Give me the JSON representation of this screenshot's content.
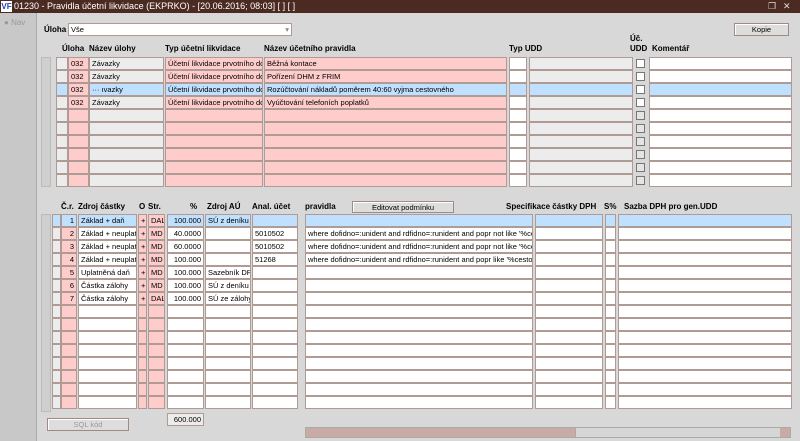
{
  "window": {
    "title": "01230 - Pravidla účetní likvidace (EKPRKO) - [20.06.2016; 08:03]  [ ]  [ ]",
    "logo": "VF",
    "restore_icon": "restore-icon",
    "close_icon": "close-icon"
  },
  "nav": {
    "label": "Nav"
  },
  "filter": {
    "label": "Úloha",
    "value": "Vše"
  },
  "buttons": {
    "kopie": "Kopie",
    "editovat": "Editovat podmínku",
    "sql": "SQL kód"
  },
  "top_grid": {
    "headers": {
      "uloha": "Úloha",
      "nazev": "Název úlohy",
      "typ": "Typ účetní likvidace",
      "pravidlo": "Název účetního pravidla",
      "typ_udd": "Typ UDD",
      "uc_udd": "Úč. UDD",
      "komentar": "Komentář"
    },
    "rows": [
      {
        "uloha": "032",
        "nazev": "Závazky",
        "typ": "Účetní likvidace prvotního do",
        "pravidlo": "Běžná kontace"
      },
      {
        "uloha": "032",
        "nazev": "Závazky",
        "typ": "Účetní likvidace prvotního do",
        "pravidlo": "Pořízení DHM z FRIM"
      },
      {
        "uloha": "032",
        "nazev": "··· ıvazky",
        "typ": "Účetní likvidace prvotního do",
        "pravidlo": "Rozúčtování nákladů poměrem 40:60 vyjma cestovného"
      },
      {
        "uloha": "032",
        "nazev": "Závazky",
        "typ": "Účetní likvidace prvotního do",
        "pravidlo": "Vyúčtování telefoních poplatků"
      }
    ],
    "selected_row": 2,
    "total_rows": 10
  },
  "bottom_grid": {
    "headers": {
      "cr": "Č.r.",
      "zdroj": "Zdroj částky",
      "o": "O",
      "str": "Str.",
      "pct": "%",
      "zdroj_au": "Zdroj AÚ",
      "anal": "Anal. účet",
      "pravidla": "pravidla",
      "spec": "Specifikace částky DPH",
      "s": "S%",
      "sazba": "Sazba DPH pro gen.UDD"
    },
    "rows": [
      {
        "cr": "1",
        "zdroj": "Základ + daň",
        "o": "+",
        "str": "DAL",
        "pct": "100.000",
        "zdroj_au": "SÚ z deníku",
        "anal": "",
        "pravidla": ""
      },
      {
        "cr": "2",
        "zdroj": "Základ + neuplatr",
        "o": "+",
        "str": "MD",
        "pct": "40.0000",
        "zdroj_au": "",
        "anal": "5010502",
        "pravidla": "where dofidno=:unident and rdfidno=:runident and popr not like '%co"
      },
      {
        "cr": "3",
        "zdroj": "Základ + neuplatr",
        "o": "+",
        "str": "MD",
        "pct": "60.0000",
        "zdroj_au": "",
        "anal": "5010502",
        "pravidla": "where dofidno=:unident and rdfidno=:runident and popr not like '%co"
      },
      {
        "cr": "4",
        "zdroj": "Základ + neuplatr",
        "o": "+",
        "str": "MD",
        "pct": "100.000",
        "zdroj_au": "",
        "anal": "51268",
        "pravidla": "where dofidno=:unident and rdfidno=:runident and popr like '%cesto"
      },
      {
        "cr": "5",
        "zdroj": "Uplatněná daň",
        "o": "+",
        "str": "MD",
        "pct": "100.000",
        "zdroj_au": "Sazebník DPH",
        "anal": "",
        "pravidla": ""
      },
      {
        "cr": "6",
        "zdroj": "Částka zálohy",
        "o": "+",
        "str": "MD",
        "pct": "100.000",
        "zdroj_au": "SÚ z deníku",
        "anal": "",
        "pravidla": ""
      },
      {
        "cr": "7",
        "zdroj": "Částka zálohy",
        "o": "+",
        "str": "DAL",
        "pct": "100.000",
        "zdroj_au": "SÚ ze zálohy",
        "anal": "",
        "pravidla": ""
      }
    ],
    "selected_row": 0,
    "total_rows": 15,
    "sum": "600.000"
  },
  "hscroll": {
    "position_fraction": 0.55
  }
}
